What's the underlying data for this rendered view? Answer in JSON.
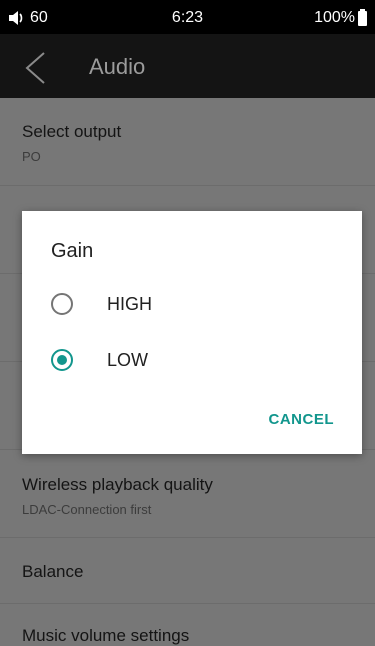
{
  "status_bar": {
    "volume": "60",
    "time": "6:23",
    "battery": "100%"
  },
  "app_bar": {
    "title": "Audio"
  },
  "list": [
    {
      "label": "Select output",
      "sub": "PO"
    },
    {
      "label": "Wireless playback quality",
      "sub": "LDAC-Connection first"
    },
    {
      "label": "Balance",
      "sub": ""
    },
    {
      "label": "Music volume settings",
      "sub": ""
    }
  ],
  "dialog": {
    "title": "Gain",
    "options": [
      {
        "label": "HIGH",
        "selected": false
      },
      {
        "label": "LOW",
        "selected": true
      }
    ],
    "cancel": "CANCEL"
  },
  "colors": {
    "accent": "#12968d",
    "app_bar": "#141414",
    "background": "#777777"
  }
}
